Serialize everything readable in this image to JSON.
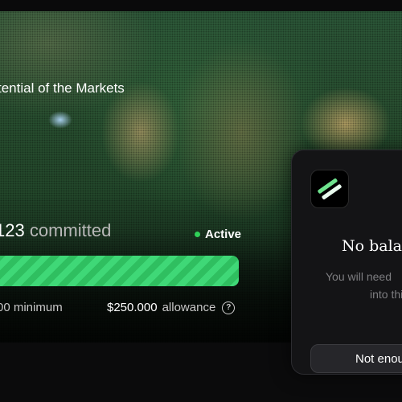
{
  "hero": {
    "title": "tential of the Markets",
    "committed_amount": "123",
    "committed_label": "committed",
    "status_label": "Active",
    "progress_fraction": 1.0,
    "minimum_text": "00 minimum",
    "allowance_value": "$250.000",
    "allowance_label": "allowance"
  },
  "modal": {
    "icon": "brand-logo-icon",
    "title": "No balan",
    "body_line1": "You will need",
    "body_line2": "into this",
    "button_label": "Not enou"
  },
  "colors": {
    "accent_green": "#3fd877",
    "status_dot": "#30d158",
    "modal_bg": "#141416"
  }
}
